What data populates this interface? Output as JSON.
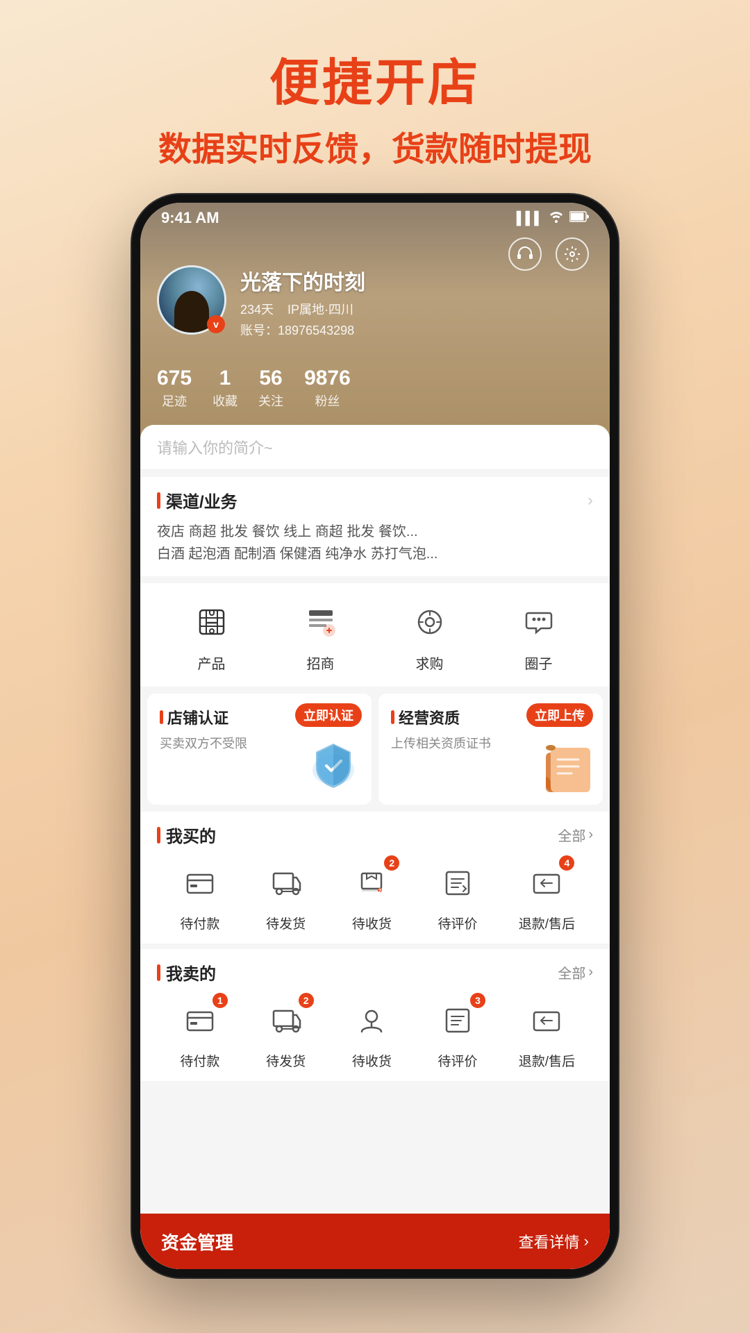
{
  "page": {
    "title1": "便捷开店",
    "title2": "数据实时反馈，货款随时提现"
  },
  "statusBar": {
    "time": "9:41 AM",
    "signal": "▌▌▌",
    "wifi": "WiFi",
    "battery": "🔋"
  },
  "profile": {
    "name": "光落下的时刻",
    "days": "234天",
    "ip": "IP属地·四川",
    "account": "账号：18976543298",
    "stats": [
      {
        "num": "675",
        "label": "足迹"
      },
      {
        "num": "1",
        "label": "收藏"
      },
      {
        "num": "56",
        "label": "关注"
      },
      {
        "num": "9876",
        "label": "粉丝"
      }
    ],
    "vBadge": "v"
  },
  "bio": {
    "placeholder": "请输入你的简介~"
  },
  "channels": {
    "title": "渠道/业务",
    "row1": "夜店  商超  批发  餐饮  线上  商超  批发  餐饮...",
    "row2": "白酒  起泡酒  配制酒  保健酒  纯净水  苏打气泡..."
  },
  "quickIcons": [
    {
      "icon": "🛍",
      "label": "产品"
    },
    {
      "icon": "📋",
      "label": "招商"
    },
    {
      "icon": "🔍",
      "label": "求购"
    },
    {
      "icon": "💬",
      "label": "圈子"
    }
  ],
  "cards": [
    {
      "title": "店铺认证",
      "badge": "立即认证",
      "desc": "买卖双方不受限"
    },
    {
      "title": "经营资质",
      "badge": "立即上传",
      "desc": "上传相关资质证书"
    }
  ],
  "myBuy": {
    "title": "我买的",
    "allLabel": "全部",
    "items": [
      {
        "icon": "💳",
        "label": "待付款",
        "badge": null
      },
      {
        "icon": "📦",
        "label": "待发货",
        "badge": null
      },
      {
        "icon": "🚚",
        "label": "待收货",
        "badge": "2"
      },
      {
        "icon": "✏️",
        "label": "待评价",
        "badge": null
      },
      {
        "icon": "↩️",
        "label": "退款/售后",
        "badge": "4"
      }
    ]
  },
  "mySell": {
    "title": "我卖的",
    "allLabel": "全部",
    "items": [
      {
        "icon": "💳",
        "label": "待付款",
        "badge": "1"
      },
      {
        "icon": "📦",
        "label": "待发货",
        "badge": "2"
      },
      {
        "icon": "🚚",
        "label": "待收货",
        "badge": null
      },
      {
        "icon": "✏️",
        "label": "待评价",
        "badge": "3"
      },
      {
        "icon": "↩️",
        "label": "退款/售后",
        "badge": null
      }
    ]
  },
  "bottomBar": {
    "title": "资金管理",
    "link": "查看详情"
  },
  "colors": {
    "accent": "#e84118",
    "dark": "#222222",
    "light": "#f5f5f5"
  }
}
